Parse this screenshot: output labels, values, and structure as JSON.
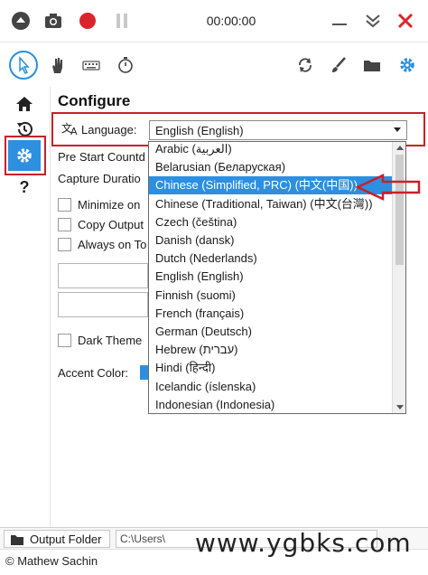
{
  "toolbar": {
    "timer": "00:00:00",
    "icons": [
      "record-dot-icon",
      "screenshot-icon",
      "record-icon",
      "pause-icon",
      "minimize-icon",
      "collapse-icon",
      "close-icon"
    ]
  },
  "tools": {
    "icons": [
      "cursor-icon",
      "hand-icon",
      "keyboard-icon",
      "timer-icon",
      "refresh-icon",
      "brush-icon",
      "folder-icon",
      "settings-icon"
    ]
  },
  "sidebar": {
    "items": [
      "home-icon",
      "history-icon",
      "settings-icon",
      "help-icon"
    ],
    "help_glyph": "?"
  },
  "main": {
    "title": "Configure",
    "language_label": "Language:",
    "language_value": "English (English)",
    "pre_start_label": "Pre Start Countd",
    "capture_duration_label": "Capture Duratio",
    "minimize_label": "Minimize on",
    "copy_output_label": "Copy Output",
    "always_on_top_label": "Always on To",
    "dark_theme_label": "Dark Theme",
    "accent_color_label": "Accent Color:"
  },
  "dropdown": {
    "items": [
      "Arabic (العربية)",
      "Belarusian (Беларуская)",
      "Chinese (Simplified, PRC) (中文(中国))",
      "Chinese (Traditional, Taiwan) (中文(台灣))",
      "Czech (čeština)",
      "Danish (dansk)",
      "Dutch (Nederlands)",
      "English (English)",
      "Finnish (suomi)",
      "French (français)",
      "German (Deutsch)",
      "Hebrew (עברית)",
      "Hindi (हिन्दी)",
      "Icelandic (íslenska)",
      "Indonesian (Indonesia)"
    ],
    "selected_index": 2
  },
  "footer": {
    "output_folder_label": "Output Folder",
    "output_path": "C:\\Users\\",
    "copyright": "© Mathew Sachin",
    "watermark": "www.ygbks.com"
  },
  "colors": {
    "accent": "#2d8fe0",
    "highlight_red": "#c8202a",
    "record_red": "#d9262c"
  }
}
